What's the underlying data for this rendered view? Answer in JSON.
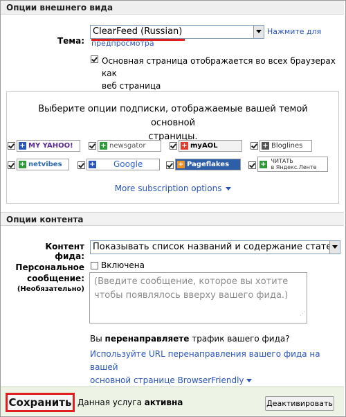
{
  "appearance": {
    "header": "Опции внешнего вида",
    "theme_label": "Тема:",
    "theme_value": "ClearFeed (Russian)",
    "preview_link_1": "Нажмите для",
    "preview_link_2": "предпросмотра",
    "all_browsers_line1": "Основная страница отображается во всех браузерах как",
    "all_browsers_line2": "веб страница"
  },
  "subscription": {
    "intro_line1": "Выберите опции подписки, отображаемые вашей темой основной",
    "intro_line2": "страницы.",
    "badges": {
      "myyahoo": "MY YAHOO!",
      "newsgator": "newsgator",
      "myaol": "myAOL",
      "bloglines": "Bloglines",
      "netvibes": "netvibes",
      "google": "Google",
      "pageflakes": "Pageflakes",
      "yandex_line1": "ЧИТАТЬ",
      "yandex_line2": "в Яндекс.Ленте"
    },
    "more_options": "More subscription options"
  },
  "content": {
    "header": "Опции контента",
    "feed_label": "Контент фида:",
    "feed_value": "Показывать список названий и содержание статей",
    "personal_label_1": "Персональное",
    "personal_label_2": "сообщение:",
    "personal_label_3": "(Необязательно)",
    "enabled_label": "Включена",
    "message_placeholder_1": "(Введите сообщение, которое вы хотите",
    "message_placeholder_2": "чтобы появлялось вверху вашего фида.)",
    "redirect_q_1": "Вы ",
    "redirect_q_bold": "перенаправляете",
    "redirect_q_2": " трафик вашего фида?",
    "redirect_link_1": "Используйте URL перенаправления вашего фида на вашей",
    "redirect_link_2": "основной странице BrowserFriendly"
  },
  "footer": {
    "save": "Сохранить",
    "status_1": "Данная услуга ",
    "status_bold": "активна",
    "deactivate": "Деактивировать"
  },
  "colors": {
    "link": "#2a55b8",
    "save_outline": "#e02020",
    "footer_bg": "#eef4e5"
  }
}
